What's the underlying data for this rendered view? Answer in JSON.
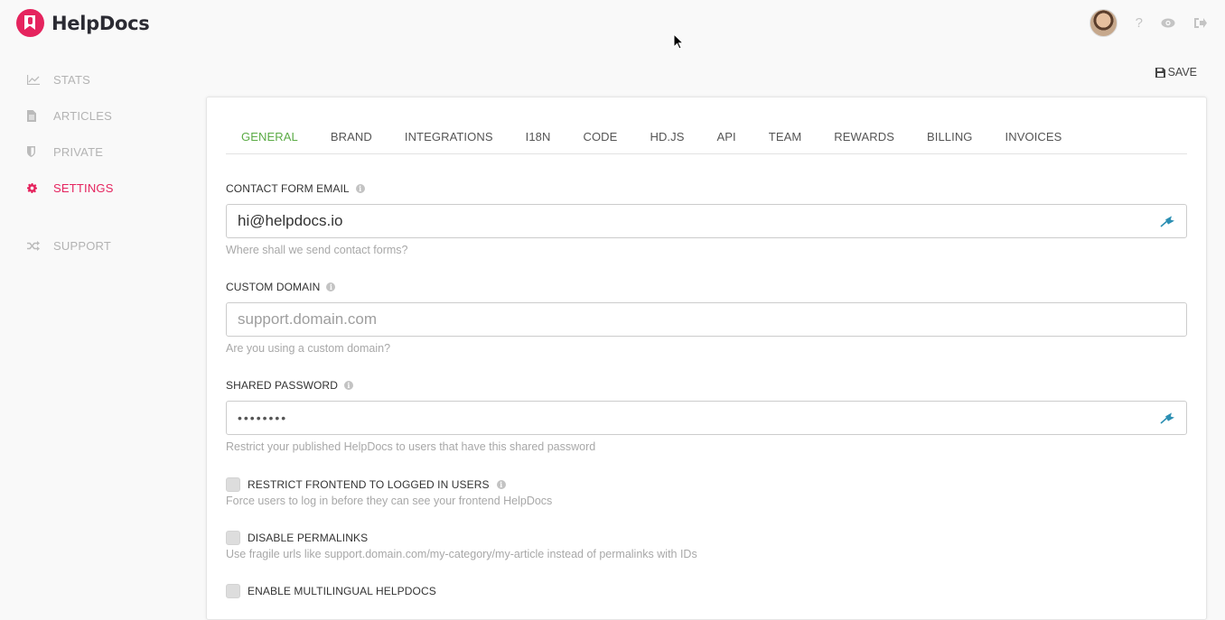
{
  "app": {
    "name": "HelpDocs"
  },
  "topbar": {
    "icons": [
      "avatar",
      "question-icon",
      "eye-icon",
      "sign-out-icon"
    ],
    "help_glyph": "?"
  },
  "sidebar": {
    "items": [
      {
        "label": "STATS",
        "icon": "line-chart-icon",
        "active": false
      },
      {
        "label": "ARTICLES",
        "icon": "file-text-icon",
        "active": false
      },
      {
        "label": "PRIVATE",
        "icon": "shield-icon",
        "active": false
      },
      {
        "label": "SETTINGS",
        "icon": "gear-icon",
        "active": true
      },
      {
        "label": "SUPPORT",
        "icon": "random-icon",
        "active": false
      }
    ]
  },
  "toolbar": {
    "save_label": "SAVE"
  },
  "tabs": [
    {
      "label": "GENERAL",
      "active": true
    },
    {
      "label": "BRAND"
    },
    {
      "label": "INTEGRATIONS"
    },
    {
      "label": "I18N"
    },
    {
      "label": "CODE"
    },
    {
      "label": "HD.JS"
    },
    {
      "label": "API"
    },
    {
      "label": "TEAM"
    },
    {
      "label": "REWARDS"
    },
    {
      "label": "BILLING"
    },
    {
      "label": "INVOICES"
    }
  ],
  "form": {
    "contact_email": {
      "label": "CONTACT FORM EMAIL",
      "value": "hi@helpdocs.io",
      "help": "Where shall we send contact forms?"
    },
    "custom_domain": {
      "label": "CUSTOM DOMAIN",
      "placeholder": "support.domain.com",
      "help": "Are you using a custom domain?"
    },
    "shared_password": {
      "label": "SHARED PASSWORD",
      "value": "••••••••",
      "help": "Restrict your published HelpDocs to users that have this shared password"
    },
    "restrict_frontend": {
      "label": "RESTRICT FRONTEND TO LOGGED IN USERS",
      "help": "Force users to log in before they can see your frontend HelpDocs",
      "checked": false
    },
    "disable_permalinks": {
      "label": "DISABLE PERMALINKS",
      "help": "Use fragile urls like support.domain.com/my-category/my-article instead of permalinks with IDs",
      "checked": false
    },
    "enable_multilingual": {
      "label": "ENABLE MULTILINGUAL HELPDOCS",
      "checked": false
    }
  },
  "colors": {
    "brand": "#e5245e",
    "active_tab": "#5bab45",
    "muted": "#b3b3b3"
  }
}
